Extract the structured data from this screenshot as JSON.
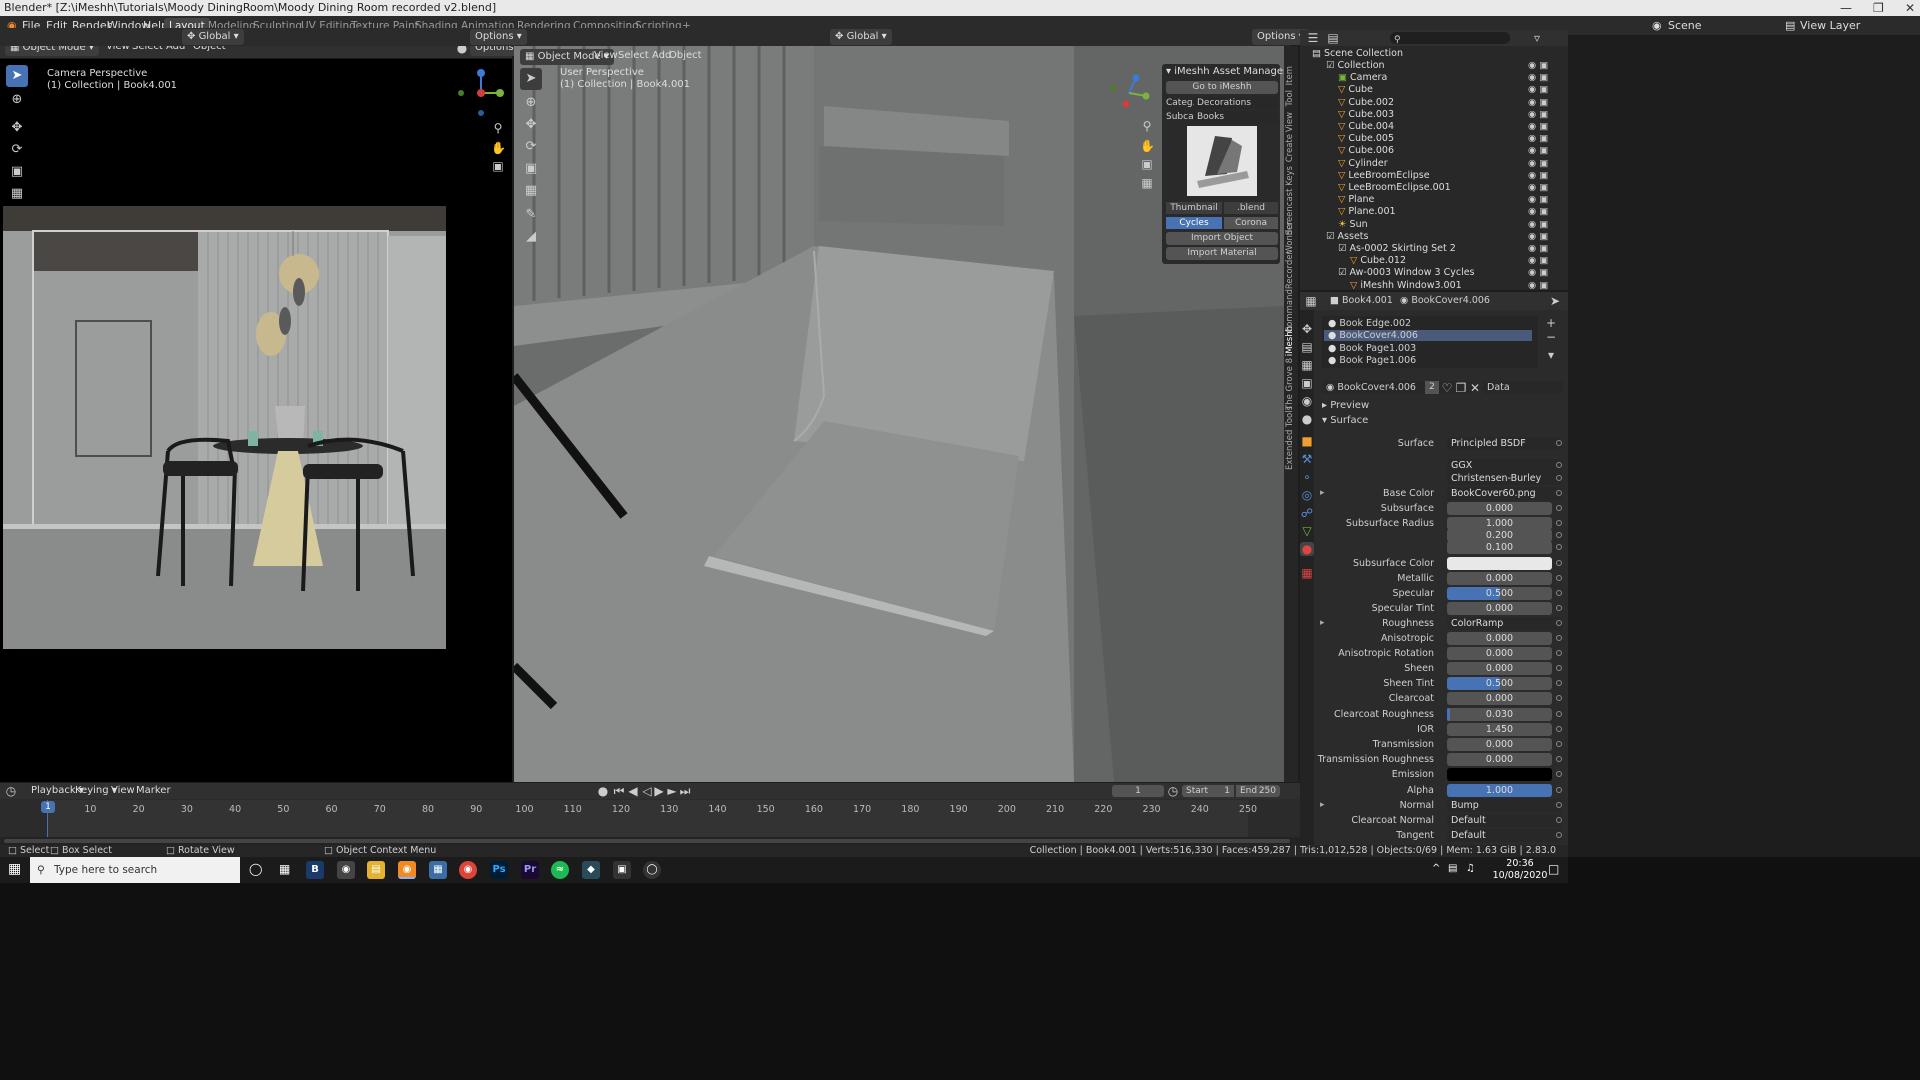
{
  "window_title": "Blender* [Z:\\iMeshh\\Tutorials\\Moody DiningRoom\\Moody Dining Room recorded v2.blend]",
  "menus": [
    "File",
    "Edit",
    "Render",
    "Window",
    "Help"
  ],
  "workspaces": [
    "Layout",
    "Modeling",
    "Sculpting",
    "UV Editing",
    "Texture Paint",
    "Shading",
    "Animation",
    "Rendering",
    "Compositing",
    "Scripting",
    "+"
  ],
  "active_workspace": "Layout",
  "scene_label": "Scene",
  "view_layer_label": "View Layer",
  "left_view": {
    "mode": "Object Mode",
    "menu": [
      "View",
      "Select",
      "Add",
      "Object"
    ],
    "transform": "Global",
    "options": "Options",
    "title": "Camera Perspective",
    "subtitle": "(1) Collection | Book4.001"
  },
  "right_view": {
    "mode": "Object Mode",
    "menu": [
      "View",
      "Select",
      "Add",
      "Object"
    ],
    "transform": "Global",
    "options": "Options",
    "title": "User Perspective",
    "subtitle": "(1) Collection | Book4.001"
  },
  "imeshh_panel": {
    "title": "iMeshh Asset Manager",
    "go_button": "Go to iMeshh",
    "category_label": "Categ...",
    "category_value": "Decorations",
    "subcategory_label": "Subca...",
    "subcategory_value": "Books",
    "thumbnail_tab": "Thumbnail",
    "blend_tab": ".blend",
    "engine_active": "Cycles",
    "engine_other": "Corona",
    "import_object": "Import Object",
    "import_material": "Import Material"
  },
  "side_tabs": [
    "Item",
    "Tool",
    "View",
    "Create",
    "Screencast Keys",
    "Wonder",
    "CommandRecorder",
    "iMeshh",
    "The Grove 8",
    "Extended Tools"
  ],
  "outliner": {
    "root": "Scene Collection",
    "rows": [
      {
        "name": "Collection",
        "level": 1,
        "kind": "collection"
      },
      {
        "name": "Camera",
        "level": 2,
        "kind": "camera"
      },
      {
        "name": "Cube",
        "level": 2,
        "kind": "object"
      },
      {
        "name": "Cube.002",
        "level": 2,
        "kind": "object"
      },
      {
        "name": "Cube.003",
        "level": 2,
        "kind": "object"
      },
      {
        "name": "Cube.004",
        "level": 2,
        "kind": "object"
      },
      {
        "name": "Cube.005",
        "level": 2,
        "kind": "object"
      },
      {
        "name": "Cube.006",
        "level": 2,
        "kind": "object"
      },
      {
        "name": "Cylinder",
        "level": 2,
        "kind": "object"
      },
      {
        "name": "LeeBroomEclipse",
        "level": 2,
        "kind": "object"
      },
      {
        "name": "LeeBroomEclipse.001",
        "level": 2,
        "kind": "object"
      },
      {
        "name": "Plane",
        "level": 2,
        "kind": "object"
      },
      {
        "name": "Plane.001",
        "level": 2,
        "kind": "object"
      },
      {
        "name": "Sun",
        "level": 2,
        "kind": "light"
      },
      {
        "name": "Assets",
        "level": 1,
        "kind": "collection"
      },
      {
        "name": "As-0002 Skirting Set 2",
        "level": 2,
        "kind": "collection"
      },
      {
        "name": "Cube.012",
        "level": 3,
        "kind": "object"
      },
      {
        "name": "Aw-0003 Window 3 Cycles",
        "level": 2,
        "kind": "collection"
      },
      {
        "name": "iMeshh Window3.001",
        "level": 3,
        "kind": "object"
      }
    ]
  },
  "properties": {
    "object_name": "Book4.001",
    "material_name": "BookCover4.006",
    "slots": [
      "Book Edge.002",
      "BookCover4.006",
      "Book Page1.003",
      "Book Page1.006"
    ],
    "active_slot": "BookCover4.006",
    "material_field": "BookCover4.006",
    "users": "2",
    "data_label": "Data",
    "preview": "Preview",
    "surface_section": "Surface",
    "rows": [
      {
        "label": "Surface",
        "type": "text",
        "value": "Principled BSDF"
      },
      {
        "label": "",
        "type": "text",
        "value": "GGX"
      },
      {
        "label": "",
        "type": "text",
        "value": "Christensen-Burley"
      },
      {
        "label": "Base Color",
        "type": "text",
        "value": "BookCover60.png"
      },
      {
        "label": "Subsurface",
        "type": "num",
        "value": "0.000",
        "fill": 0
      },
      {
        "label": "Subsurface Radius",
        "type": "num",
        "value": "1.000",
        "fill": 0
      },
      {
        "label": "",
        "type": "num",
        "value": "0.200",
        "fill": 0
      },
      {
        "label": "",
        "type": "num",
        "value": "0.100",
        "fill": 0
      },
      {
        "label": "Subsurface Color",
        "type": "color",
        "value": "#e8e8e8"
      },
      {
        "label": "Metallic",
        "type": "num",
        "value": "0.000",
        "fill": 0
      },
      {
        "label": "Specular",
        "type": "num",
        "value": "0.500",
        "fill": 0.5
      },
      {
        "label": "Specular Tint",
        "type": "num",
        "value": "0.000",
        "fill": 0
      },
      {
        "label": "Roughness",
        "type": "text",
        "value": "ColorRamp"
      },
      {
        "label": "Anisotropic",
        "type": "num",
        "value": "0.000",
        "fill": 0
      },
      {
        "label": "Anisotropic Rotation",
        "type": "num",
        "value": "0.000",
        "fill": 0
      },
      {
        "label": "Sheen",
        "type": "num",
        "value": "0.000",
        "fill": 0
      },
      {
        "label": "Sheen Tint",
        "type": "num",
        "value": "0.500",
        "fill": 0.5
      },
      {
        "label": "Clearcoat",
        "type": "num",
        "value": "0.000",
        "fill": 0
      },
      {
        "label": "Clearcoat Roughness",
        "type": "num",
        "value": "0.030",
        "fill": 0.03
      },
      {
        "label": "IOR",
        "type": "num",
        "value": "1.450",
        "fill": 0
      },
      {
        "label": "Transmission",
        "type": "num",
        "value": "0.000",
        "fill": 0
      },
      {
        "label": "Transmission Roughness",
        "type": "num",
        "value": "0.000",
        "fill": 0
      },
      {
        "label": "Emission",
        "type": "color",
        "value": "#000000"
      },
      {
        "label": "Alpha",
        "type": "num",
        "value": "1.000",
        "fill": 1
      },
      {
        "label": "Normal",
        "type": "text",
        "value": "Bump"
      },
      {
        "label": "Clearcoat Normal",
        "type": "text",
        "value": "Default"
      },
      {
        "label": "Tangent",
        "type": "text",
        "value": "Default"
      }
    ]
  },
  "timeline": {
    "menu": [
      "Playback",
      "Keying",
      "View",
      "Marker"
    ],
    "current_frame": "1",
    "start_label": "Start",
    "start": "1",
    "end_label": "End",
    "end": "250",
    "ticks": [
      "1",
      "10",
      "20",
      "30",
      "40",
      "50",
      "60",
      "70",
      "80",
      "90",
      "100",
      "110",
      "120",
      "130",
      "140",
      "150",
      "160",
      "170",
      "180",
      "190",
      "200",
      "210",
      "220",
      "230",
      "240",
      "250"
    ]
  },
  "status": {
    "select": "Select",
    "box_select": "Box Select",
    "rotate": "Rotate View",
    "context": "Object Context Menu",
    "stats": "Collection | Book4.001 | Verts:516,330 | Faces:459,287 | Tris:1,012,528 | Objects:0/69 | Mem: 1.63 GiB | 2.83.0"
  },
  "taskbar": {
    "search_placeholder": "Type here to search",
    "time": "20:36",
    "date": "10/08/2020"
  }
}
